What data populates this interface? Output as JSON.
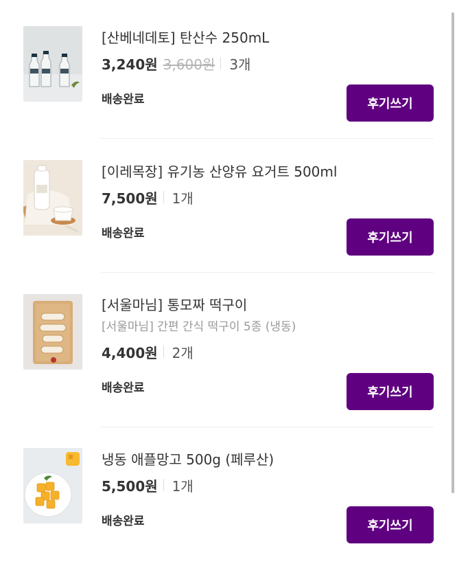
{
  "orders": [
    {
      "name": "[산베네데토] 탄산수 250mL",
      "subname": "",
      "price": "3,240원",
      "original_price": "3,600원",
      "quantity": "3개",
      "status": "배송완료",
      "review_label": "후기쓰기",
      "image": "sparkling-water-bottles"
    },
    {
      "name": "[이레목장] 유기농 산양유 요거트 500ml",
      "subname": "",
      "price": "7,500원",
      "original_price": "",
      "quantity": "1개",
      "status": "배송완료",
      "review_label": "후기쓰기",
      "image": "goat-milk-yogurt"
    },
    {
      "name": "[서울마님] 통모짜 떡구이",
      "subname": "[서울마님] 간편 간식 떡구이 5종 (냉동)",
      "price": "4,400원",
      "original_price": "",
      "quantity": "2개",
      "status": "배송완료",
      "review_label": "후기쓰기",
      "image": "grilled-rice-cake"
    },
    {
      "name": "냉동 애플망고 500g (페루산)",
      "subname": "",
      "price": "5,500원",
      "original_price": "",
      "quantity": "1개",
      "status": "배송완료",
      "review_label": "후기쓰기",
      "image": "frozen-apple-mango"
    }
  ],
  "colors": {
    "accent": "#5f0080",
    "text": "#333333",
    "muted": "#999999",
    "strike": "#b5b5b5",
    "divider": "#eeeeee"
  }
}
